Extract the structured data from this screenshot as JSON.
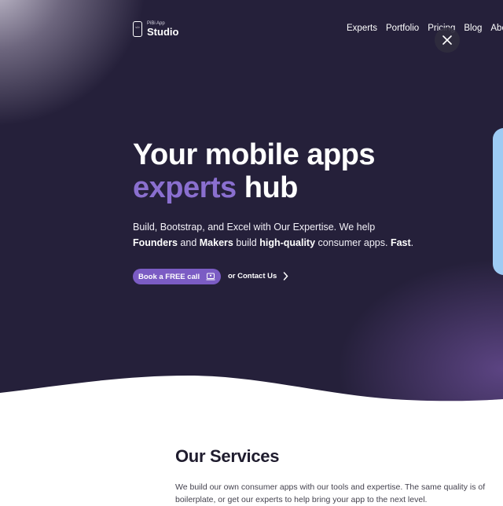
{
  "header": {
    "logo_small": "PiBi App",
    "logo_big": "Studio",
    "nav": [
      "Experts",
      "Portfolio",
      "Pricing",
      "Blog",
      "About"
    ]
  },
  "hero": {
    "title_line1": "Your mobile apps",
    "title_accent": "experts",
    "title_rest": " hub",
    "desc_line1": "Build, Bootstrap, and Excel with Our Expertise. We help",
    "desc_founders": "Founders",
    "desc_and": " and ",
    "desc_makers": "Makers",
    "desc_build": " build ",
    "desc_quality": "high-quality",
    "desc_consumer": " consumer apps. ",
    "desc_fast": "Fast",
    "desc_period": ".",
    "cta_primary": "Book a FREE call",
    "cta_secondary": "or Contact Us"
  },
  "services": {
    "title": "Our Services",
    "text_line1": "We build our own consumer apps with our tools and expertise. The same quality is of",
    "text_line2": "boilerplate, or get our experts to help bring your app to the next level."
  },
  "colors": {
    "hero_bg": "#25203a",
    "accent": "#8a6fcf",
    "button": "#7b5cc4",
    "side_card": "#9ecbf4"
  },
  "icons": {
    "logo": "phone-code-icon",
    "close": "close-icon",
    "book": "laptop-icon",
    "contact": "chevron-right-icon"
  }
}
